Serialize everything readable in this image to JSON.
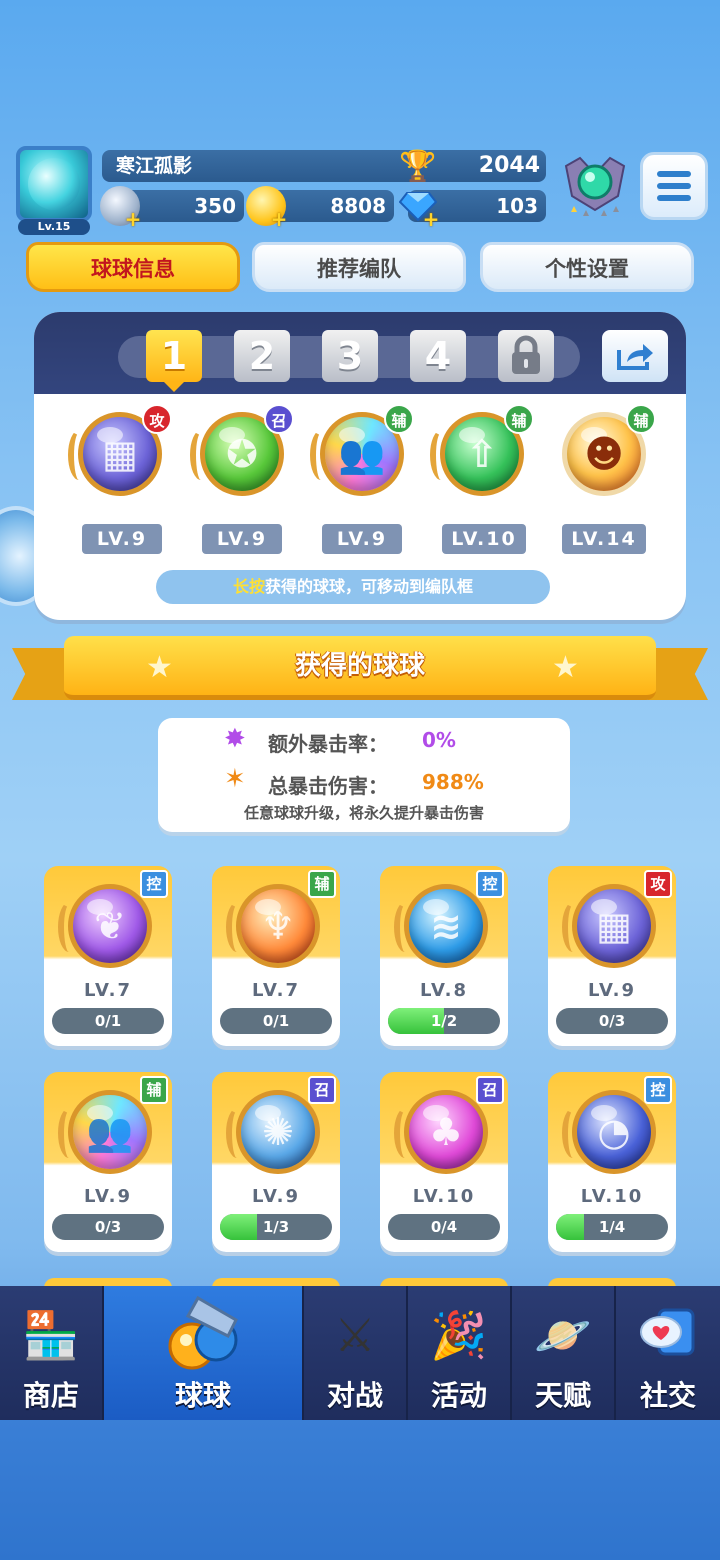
{
  "player": {
    "name": "寒江孤影",
    "level_label": "Lv.15",
    "trophies": "2044",
    "currencies": [
      {
        "icon": "silver-coin-icon",
        "value": "350"
      },
      {
        "icon": "gold-coin-icon",
        "value": "8808"
      },
      {
        "icon": "diamond-icon",
        "value": "103"
      }
    ]
  },
  "tabs": [
    "球球信息",
    "推荐编队",
    "个性设置"
  ],
  "team": {
    "slots": [
      "1",
      "2",
      "3",
      "4"
    ],
    "balls": [
      {
        "role": "攻",
        "level": "LV.9",
        "color": "purple-grid"
      },
      {
        "role": "召",
        "level": "LV.9",
        "color": "green-star"
      },
      {
        "role": "辅",
        "level": "LV.9",
        "color": "rainbow-people"
      },
      {
        "role": "辅",
        "level": "LV.10",
        "color": "green-arrow"
      },
      {
        "role": "辅",
        "level": "LV.14",
        "color": "orange-face"
      }
    ],
    "hint_highlight": "长按",
    "hint_text": "获得的球球，可移动到编队框"
  },
  "section_title": "获得的球球",
  "crit": {
    "extra_rate_label": "额外暴击率：",
    "extra_rate_value": "0%",
    "total_dmg_label": "总暴击伤害：",
    "total_dmg_value": "988%",
    "note": "任意球球升级，将永久提升暴击伤害"
  },
  "collection": [
    {
      "role": "控",
      "level": "LV.7",
      "progress": "0/1",
      "fraction": 0
    },
    {
      "role": "辅",
      "level": "LV.7",
      "progress": "0/1",
      "fraction": 0
    },
    {
      "role": "控",
      "level": "LV.8",
      "progress": "1/2",
      "fraction": 0.5
    },
    {
      "role": "攻",
      "level": "LV.9",
      "progress": "0/3",
      "fraction": 0
    },
    {
      "role": "辅",
      "level": "LV.9",
      "progress": "0/3",
      "fraction": 0
    },
    {
      "role": "召",
      "level": "LV.9",
      "progress": "1/3",
      "fraction": 0.333
    },
    {
      "role": "召",
      "level": "LV.10",
      "progress": "0/4",
      "fraction": 0
    },
    {
      "role": "控",
      "level": "LV.10",
      "progress": "1/4",
      "fraction": 0.25
    }
  ],
  "nav": [
    {
      "label": "商店",
      "icon": "shop-icon"
    },
    {
      "label": "球球",
      "icon": "ball-icon"
    },
    {
      "label": "对战",
      "icon": "swords-icon"
    },
    {
      "label": "活动",
      "icon": "party-icon"
    },
    {
      "label": "天赋",
      "icon": "planet-icon"
    },
    {
      "label": "社交",
      "icon": "chat-heart-icon"
    }
  ],
  "colors": {
    "accent_yellow": "#ffc21c",
    "role_attack": "#d8262c",
    "role_summon": "#5a4fd0",
    "role_support": "#3aa64a",
    "role_control": "#3b8fe0",
    "crit_rate": "#b14ce8",
    "crit_damage": "#f08a16"
  }
}
